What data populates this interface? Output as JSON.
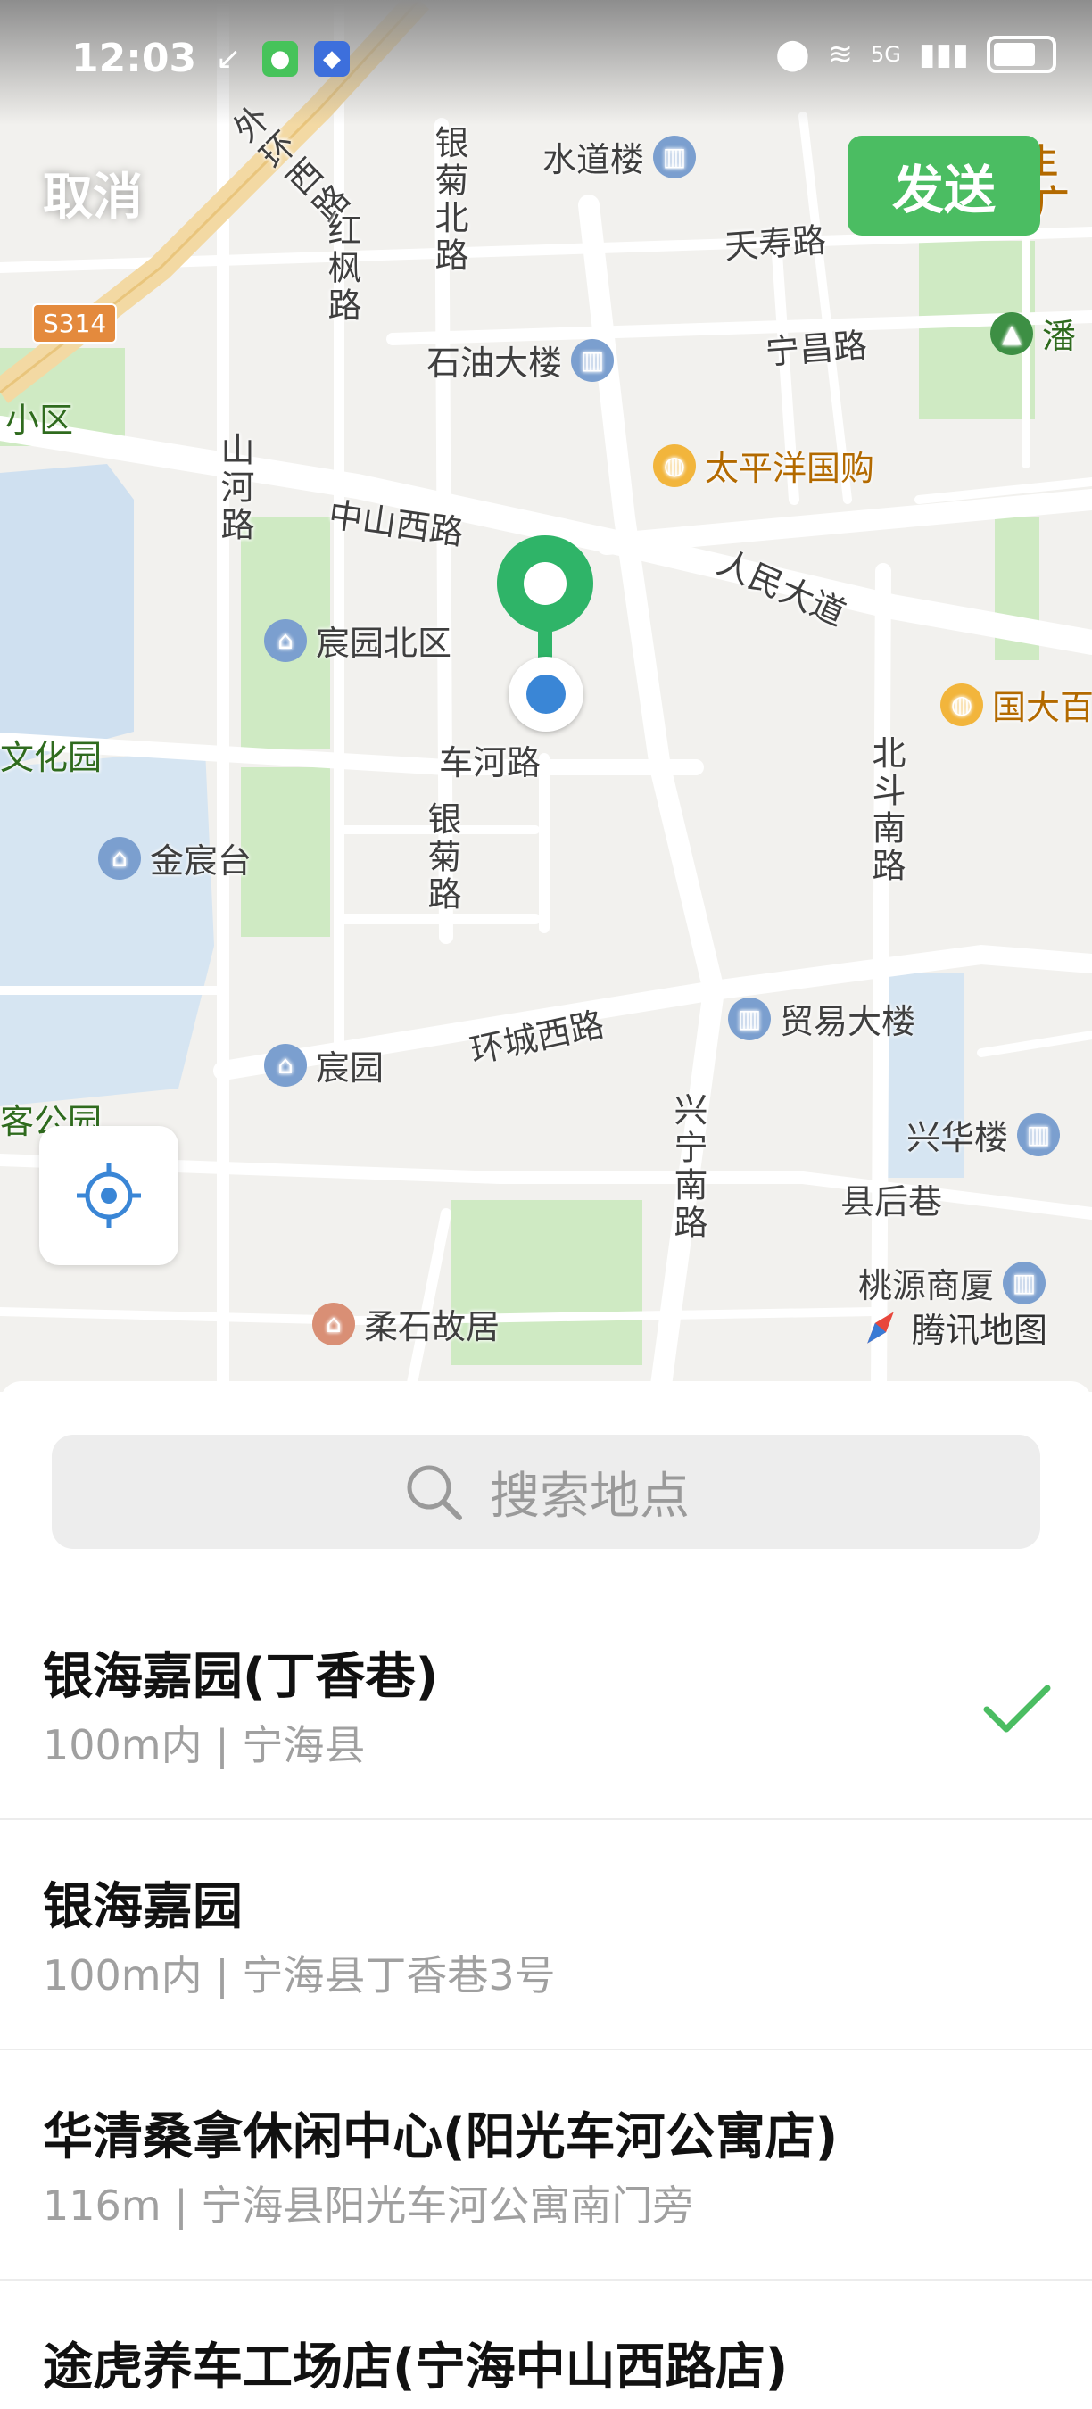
{
  "status_bar": {
    "time": "12:03",
    "network": "5G"
  },
  "header": {
    "cancel_label": "取消",
    "send_label": "发送"
  },
  "map": {
    "roads": {
      "waihuan_xi": "外环西路",
      "s314": "S314",
      "hongfeng": "红枫路",
      "yinju_bei": "银菊北路",
      "shanhe": "山河路",
      "zhongshan_xi": "中山西路",
      "tianshou": "天寿路",
      "ningchang": "宁昌路",
      "renmin": "人民大道",
      "chehe": "车河路",
      "yinju": "银菊路",
      "beidou_nan": "北斗南路",
      "huancheng_xi": "环城西路",
      "xingning_nan": "兴宁南路",
      "xianhou": "县后巷"
    },
    "pois": {
      "shuidao": "水道楼",
      "shiyou": "石油大楼",
      "taipingyang": "太平洋国购",
      "chenyuan_bei": "宸园北区",
      "jinchentai": "金宸台",
      "chenyuan": "宸园",
      "maoyi": "贸易大楼",
      "xinghua": "兴华楼",
      "taoyuan": "桃源商厦",
      "roushi": "柔石故居",
      "guoda": "国大百",
      "wenhuayuan": "文化园",
      "xiaoqu": "小区",
      "gongyuan": "客公园",
      "pan": "潘",
      "top_cut": "养生",
      "top_cut2": "广"
    },
    "brand": "腾讯地图"
  },
  "search": {
    "placeholder": "搜索地点"
  },
  "results": [
    {
      "name": "银海嘉园(丁香巷)",
      "sub": "100m内 | 宁海县",
      "selected": true
    },
    {
      "name": "银海嘉园",
      "sub": "100m内 | 宁海县丁香巷3号",
      "selected": false
    },
    {
      "name": "华清桑拿休闲中心(阳光车河公寓店)",
      "sub": "116m | 宁海县阳光车河公寓南门旁",
      "selected": false
    },
    {
      "name": "途虎养车工场店(宁海中山西路店)",
      "sub": "",
      "selected": false
    }
  ],
  "colors": {
    "accent_green": "#4bbd62",
    "location_blue": "#3a86d6"
  }
}
